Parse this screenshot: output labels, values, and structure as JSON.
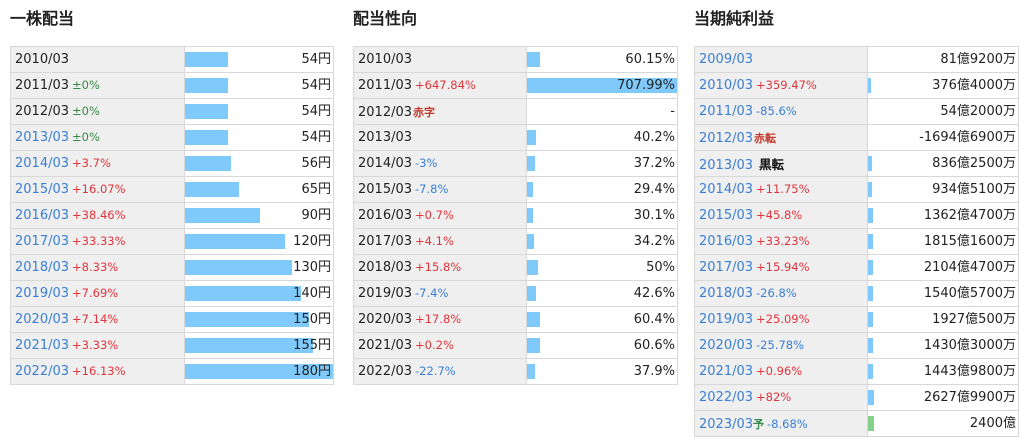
{
  "panels": [
    {
      "title": "一株配当",
      "rows": [
        {
          "year": "2010/03",
          "year_color": "dark",
          "change": "",
          "change_dir": "",
          "tag": "",
          "tag_style": "",
          "value": "54円",
          "level": 0.29,
          "bar_color": "blue"
        },
        {
          "year": "2011/03",
          "year_color": "dark",
          "change": "±0%",
          "change_dir": "zero",
          "tag": "",
          "tag_style": "",
          "value": "54円",
          "level": 0.29,
          "bar_color": "blue"
        },
        {
          "year": "2012/03",
          "year_color": "dark",
          "change": "±0%",
          "change_dir": "zero",
          "tag": "",
          "tag_style": "",
          "value": "54円",
          "level": 0.29,
          "bar_color": "blue"
        },
        {
          "year": "2013/03",
          "year_color": "blue",
          "change": "±0%",
          "change_dir": "zero",
          "tag": "",
          "tag_style": "",
          "value": "54円",
          "level": 0.29,
          "bar_color": "blue"
        },
        {
          "year": "2014/03",
          "year_color": "blue",
          "change": "+3.7%",
          "change_dir": "up",
          "tag": "",
          "tag_style": "",
          "value": "56円",
          "level": 0.31,
          "bar_color": "blue"
        },
        {
          "year": "2015/03",
          "year_color": "blue",
          "change": "+16.07%",
          "change_dir": "up",
          "tag": "",
          "tag_style": "",
          "value": "65円",
          "level": 0.36,
          "bar_color": "blue"
        },
        {
          "year": "2016/03",
          "year_color": "blue",
          "change": "+38.46%",
          "change_dir": "up",
          "tag": "",
          "tag_style": "",
          "value": "90円",
          "level": 0.5,
          "bar_color": "blue"
        },
        {
          "year": "2017/03",
          "year_color": "blue",
          "change": "+33.33%",
          "change_dir": "up",
          "tag": "",
          "tag_style": "",
          "value": "120円",
          "level": 0.67,
          "bar_color": "blue"
        },
        {
          "year": "2018/03",
          "year_color": "blue",
          "change": "+8.33%",
          "change_dir": "up",
          "tag": "",
          "tag_style": "",
          "value": "130円",
          "level": 0.72,
          "bar_color": "blue"
        },
        {
          "year": "2019/03",
          "year_color": "blue",
          "change": "+7.69%",
          "change_dir": "up",
          "tag": "",
          "tag_style": "",
          "value": "140円",
          "level": 0.78,
          "bar_color": "blue"
        },
        {
          "year": "2020/03",
          "year_color": "blue",
          "change": "+7.14%",
          "change_dir": "up",
          "tag": "",
          "tag_style": "",
          "value": "150円",
          "level": 0.83,
          "bar_color": "blue"
        },
        {
          "year": "2021/03",
          "year_color": "blue",
          "change": "+3.33%",
          "change_dir": "up",
          "tag": "",
          "tag_style": "",
          "value": "155円",
          "level": 0.86,
          "bar_color": "blue"
        },
        {
          "year": "2022/03",
          "year_color": "blue",
          "change": "+16.13%",
          "change_dir": "up",
          "tag": "",
          "tag_style": "",
          "value": "180円",
          "level": 1.0,
          "bar_color": "blue"
        }
      ]
    },
    {
      "title": "配当性向",
      "rows": [
        {
          "year": "2010/03",
          "year_color": "dark",
          "change": "",
          "change_dir": "",
          "tag": "",
          "tag_style": "",
          "value": "60.15%",
          "level": 0.085,
          "bar_color": "blue"
        },
        {
          "year": "2011/03",
          "year_color": "dark",
          "change": "+647.84%",
          "change_dir": "up",
          "tag": "",
          "tag_style": "",
          "value": "707.99%",
          "level": 1.0,
          "bar_color": "blue"
        },
        {
          "year": "2012/03",
          "year_color": "dark",
          "change": "",
          "change_dir": "",
          "tag": "赤字",
          "tag_style": "red",
          "value": "-",
          "level": 0,
          "bar_color": "blue"
        },
        {
          "year": "2013/03",
          "year_color": "dark",
          "change": "",
          "change_dir": "",
          "tag": "",
          "tag_style": "",
          "value": "40.2%",
          "level": 0.057,
          "bar_color": "blue"
        },
        {
          "year": "2014/03",
          "year_color": "dark",
          "change": "-3%",
          "change_dir": "down",
          "tag": "",
          "tag_style": "",
          "value": "37.2%",
          "level": 0.053,
          "bar_color": "blue"
        },
        {
          "year": "2015/03",
          "year_color": "dark",
          "change": "-7.8%",
          "change_dir": "down",
          "tag": "",
          "tag_style": "",
          "value": "29.4%",
          "level": 0.042,
          "bar_color": "blue"
        },
        {
          "year": "2016/03",
          "year_color": "dark",
          "change": "+0.7%",
          "change_dir": "up",
          "tag": "",
          "tag_style": "",
          "value": "30.1%",
          "level": 0.043,
          "bar_color": "blue"
        },
        {
          "year": "2017/03",
          "year_color": "dark",
          "change": "+4.1%",
          "change_dir": "up",
          "tag": "",
          "tag_style": "",
          "value": "34.2%",
          "level": 0.048,
          "bar_color": "blue"
        },
        {
          "year": "2018/03",
          "year_color": "dark",
          "change": "+15.8%",
          "change_dir": "up",
          "tag": "",
          "tag_style": "",
          "value": "50%",
          "level": 0.071,
          "bar_color": "blue"
        },
        {
          "year": "2019/03",
          "year_color": "dark",
          "change": "-7.4%",
          "change_dir": "down",
          "tag": "",
          "tag_style": "",
          "value": "42.6%",
          "level": 0.06,
          "bar_color": "blue"
        },
        {
          "year": "2020/03",
          "year_color": "dark",
          "change": "+17.8%",
          "change_dir": "up",
          "tag": "",
          "tag_style": "",
          "value": "60.4%",
          "level": 0.085,
          "bar_color": "blue"
        },
        {
          "year": "2021/03",
          "year_color": "dark",
          "change": "+0.2%",
          "change_dir": "up",
          "tag": "",
          "tag_style": "",
          "value": "60.6%",
          "level": 0.086,
          "bar_color": "blue"
        },
        {
          "year": "2022/03",
          "year_color": "dark",
          "change": "-22.7%",
          "change_dir": "down",
          "tag": "",
          "tag_style": "",
          "value": "37.9%",
          "level": 0.054,
          "bar_color": "blue"
        }
      ]
    },
    {
      "title": "当期純利益",
      "rows": [
        {
          "year": "2009/03",
          "year_color": "blue",
          "change": "",
          "change_dir": "",
          "tag": "",
          "tag_style": "",
          "value": "81億9200万",
          "level": 0,
          "bar_color": "blue"
        },
        {
          "year": "2010/03",
          "year_color": "blue",
          "change": "+359.47%",
          "change_dir": "up",
          "tag": "",
          "tag_style": "",
          "value": "376億4000万",
          "level": 0.016,
          "bar_color": "blue"
        },
        {
          "year": "2011/03",
          "year_color": "blue",
          "change": "-85.6%",
          "change_dir": "down",
          "tag": "",
          "tag_style": "",
          "value": "54億2000万",
          "level": 0,
          "bar_color": "blue"
        },
        {
          "year": "2012/03",
          "year_color": "blue",
          "change": "",
          "change_dir": "",
          "tag": "赤転",
          "tag_style": "red",
          "value": "-1694億6900万",
          "level": 0,
          "bar_color": "blue"
        },
        {
          "year": "2013/03",
          "year_color": "blue",
          "change": "",
          "change_dir": "",
          "tag": "黒転",
          "tag_style": "black",
          "value": "836億2500万",
          "level": 0.025,
          "bar_color": "blue"
        },
        {
          "year": "2014/03",
          "year_color": "blue",
          "change": "+11.75%",
          "change_dir": "up",
          "tag": "",
          "tag_style": "",
          "value": "934億5100万",
          "level": 0.028,
          "bar_color": "blue"
        },
        {
          "year": "2015/03",
          "year_color": "blue",
          "change": "+45.8%",
          "change_dir": "up",
          "tag": "",
          "tag_style": "",
          "value": "1362億4700万",
          "level": 0.03,
          "bar_color": "blue"
        },
        {
          "year": "2016/03",
          "year_color": "blue",
          "change": "+33.23%",
          "change_dir": "up",
          "tag": "",
          "tag_style": "",
          "value": "1815億1600万",
          "level": 0.033,
          "bar_color": "blue"
        },
        {
          "year": "2017/03",
          "year_color": "blue",
          "change": "+15.94%",
          "change_dir": "up",
          "tag": "",
          "tag_style": "",
          "value": "2104億4700万",
          "level": 0.036,
          "bar_color": "blue"
        },
        {
          "year": "2018/03",
          "year_color": "blue",
          "change": "-26.8%",
          "change_dir": "down",
          "tag": "",
          "tag_style": "",
          "value": "1540億5700万",
          "level": 0.03,
          "bar_color": "blue"
        },
        {
          "year": "2019/03",
          "year_color": "blue",
          "change": "+25.09%",
          "change_dir": "up",
          "tag": "",
          "tag_style": "",
          "value": "1927億500万",
          "level": 0.033,
          "bar_color": "blue"
        },
        {
          "year": "2020/03",
          "year_color": "blue",
          "change": "-25.78%",
          "change_dir": "down",
          "tag": "",
          "tag_style": "",
          "value": "1430億3000万",
          "level": 0.03,
          "bar_color": "blue"
        },
        {
          "year": "2021/03",
          "year_color": "blue",
          "change": "+0.96%",
          "change_dir": "up",
          "tag": "",
          "tag_style": "",
          "value": "1443億9800万",
          "level": 0.03,
          "bar_color": "blue"
        },
        {
          "year": "2022/03",
          "year_color": "blue",
          "change": "+82%",
          "change_dir": "up",
          "tag": "",
          "tag_style": "",
          "value": "2627億9900万",
          "level": 0.041,
          "bar_color": "blue"
        },
        {
          "year": "2023/03",
          "year_color": "blue",
          "change": "-8.68%",
          "change_dir": "down",
          "tag": "予",
          "tag_style": "green",
          "value": "2400億",
          "level": 0.038,
          "bar_color": "green"
        }
      ]
    }
  ]
}
